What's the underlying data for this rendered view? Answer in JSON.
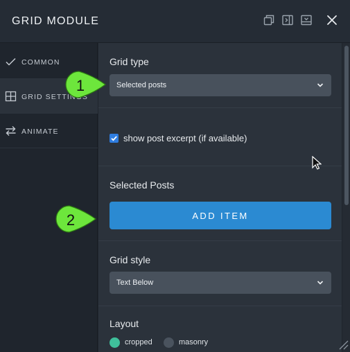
{
  "header": {
    "title": "GRID MODULE",
    "icons": [
      "duplicate-icon",
      "dock-right-icon",
      "dock-bottom-icon",
      "close-icon"
    ]
  },
  "sidebar": {
    "items": [
      {
        "label": "COMMON",
        "icon": "checkmark-icon",
        "active": false
      },
      {
        "label": "GRID SETTINGS",
        "icon": "grid-icon",
        "active": true
      },
      {
        "label": "ANIMATE",
        "icon": "swap-arrows-icon",
        "active": false
      }
    ]
  },
  "main": {
    "grid_type": {
      "label": "Grid type",
      "value": "Selected posts"
    },
    "excerpt": {
      "label": "show post excerpt (if available)",
      "checked": true
    },
    "selected_posts": {
      "label": "Selected Posts",
      "button_label": "ADD ITEM"
    },
    "grid_style": {
      "label": "Grid style",
      "value": "Text Below"
    },
    "layout": {
      "label": "Layout",
      "options": [
        {
          "label": "cropped",
          "selected": true
        },
        {
          "label": "masonry",
          "selected": false
        }
      ]
    }
  },
  "callouts": [
    "1",
    "2"
  ],
  "colors": {
    "accent": "#2b8ad2",
    "checkbox": "#2f7de0",
    "radio_selected": "#3fc09b",
    "callout_green": "#6de63c"
  }
}
